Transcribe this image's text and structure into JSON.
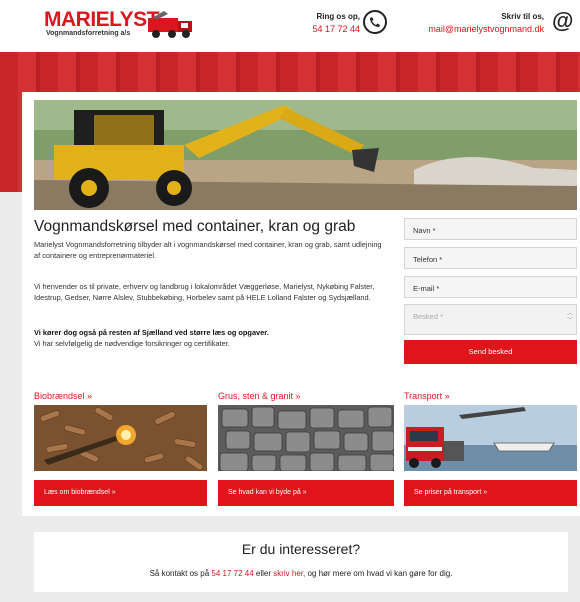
{
  "header": {
    "logo_title": "MARIELYST",
    "logo_subtitle": "Vognmandsforretning a/s",
    "phone_label": "Ring os op,",
    "phone_number": "54 17 72 44",
    "phone_icon": "phone-icon",
    "mail_label": "Skriv til os,",
    "mail_address": "mail@marielystvognmand.dk",
    "mail_icon": "at-icon",
    "at_symbol": "@"
  },
  "main": {
    "title": "Vognmandskørsel med container, kran og grab",
    "p1": "Marielyst Vognmandsforretning tilbyder alt i vognmandskørsel med container, kran og grab, samt udlejning af containere og entreprenørmateriel.",
    "p2": "Vi henvender os til private, erhverv og landbrug i lokalområdet Væggerløse, Marielyst, Nykøbing Falster, Idestrup, Gedser, Nørre Alslev, Stubbekøbing, Horbelev samt på HELE Lolland Falster og Sydsjælland.",
    "p3": "Vi kører dog også på resten af Sjælland ved større læs og opgaver.",
    "p4": "Vi har selvfølgelig de nødvendige forsikringer og certifikater."
  },
  "form": {
    "name_placeholder": "Navn *",
    "phone_placeholder": "Telefon *",
    "email_placeholder": "E-mail *",
    "message_placeholder": "Besked *",
    "send_label": "Send besked"
  },
  "columns": [
    {
      "title": "Biobrændsel »",
      "button": "Læs om biobrændsel »"
    },
    {
      "title": "Grus, sten & granit »",
      "button": "Se hvad kan vi byde på »"
    },
    {
      "title": "Transport »",
      "button": "Se priser på transport »"
    }
  ],
  "interest": {
    "title": "Er du interesseret?",
    "text_before": "Så kontakt os på ",
    "phone": "54 17 72 44",
    "text_middle": " eller ",
    "link": "skriv her",
    "text_after": ", og hør mere om hvad vi kan gøre for dig."
  },
  "colors": {
    "accent": "#e0141b",
    "brand_red": "#d8171e"
  }
}
